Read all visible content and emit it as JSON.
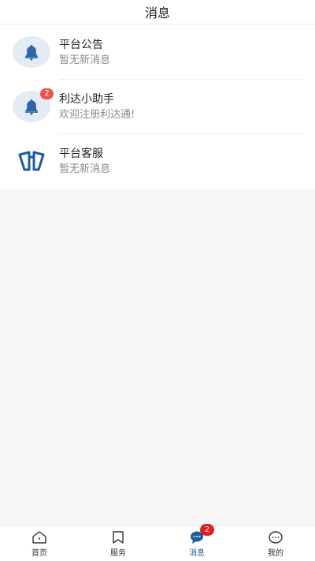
{
  "header": {
    "title": "消息"
  },
  "messages": [
    {
      "name": "平台公告",
      "preview": "暂无新消息",
      "icon": "bell-icon",
      "badge": null
    },
    {
      "name": "利达小助手",
      "preview": "欢迎注册利达通!",
      "icon": "bell-icon",
      "badge": "2"
    },
    {
      "name": "平台客服",
      "preview": "暂无新消息",
      "icon": "service-logo-icon",
      "badge": null
    }
  ],
  "tabbar": {
    "tabs": [
      {
        "label": "首页",
        "icon": "home-icon"
      },
      {
        "label": "服务",
        "icon": "bookmark-icon"
      },
      {
        "label": "消息",
        "icon": "chat-bubble-icon",
        "badge": "2",
        "active": true
      },
      {
        "label": "我的",
        "icon": "profile-chat-icon"
      }
    ]
  },
  "colors": {
    "accent": "#1f5d9c",
    "badge": "#e02020",
    "bell": "#2b66a8",
    "avatar_bg": "#e3ebf3"
  }
}
